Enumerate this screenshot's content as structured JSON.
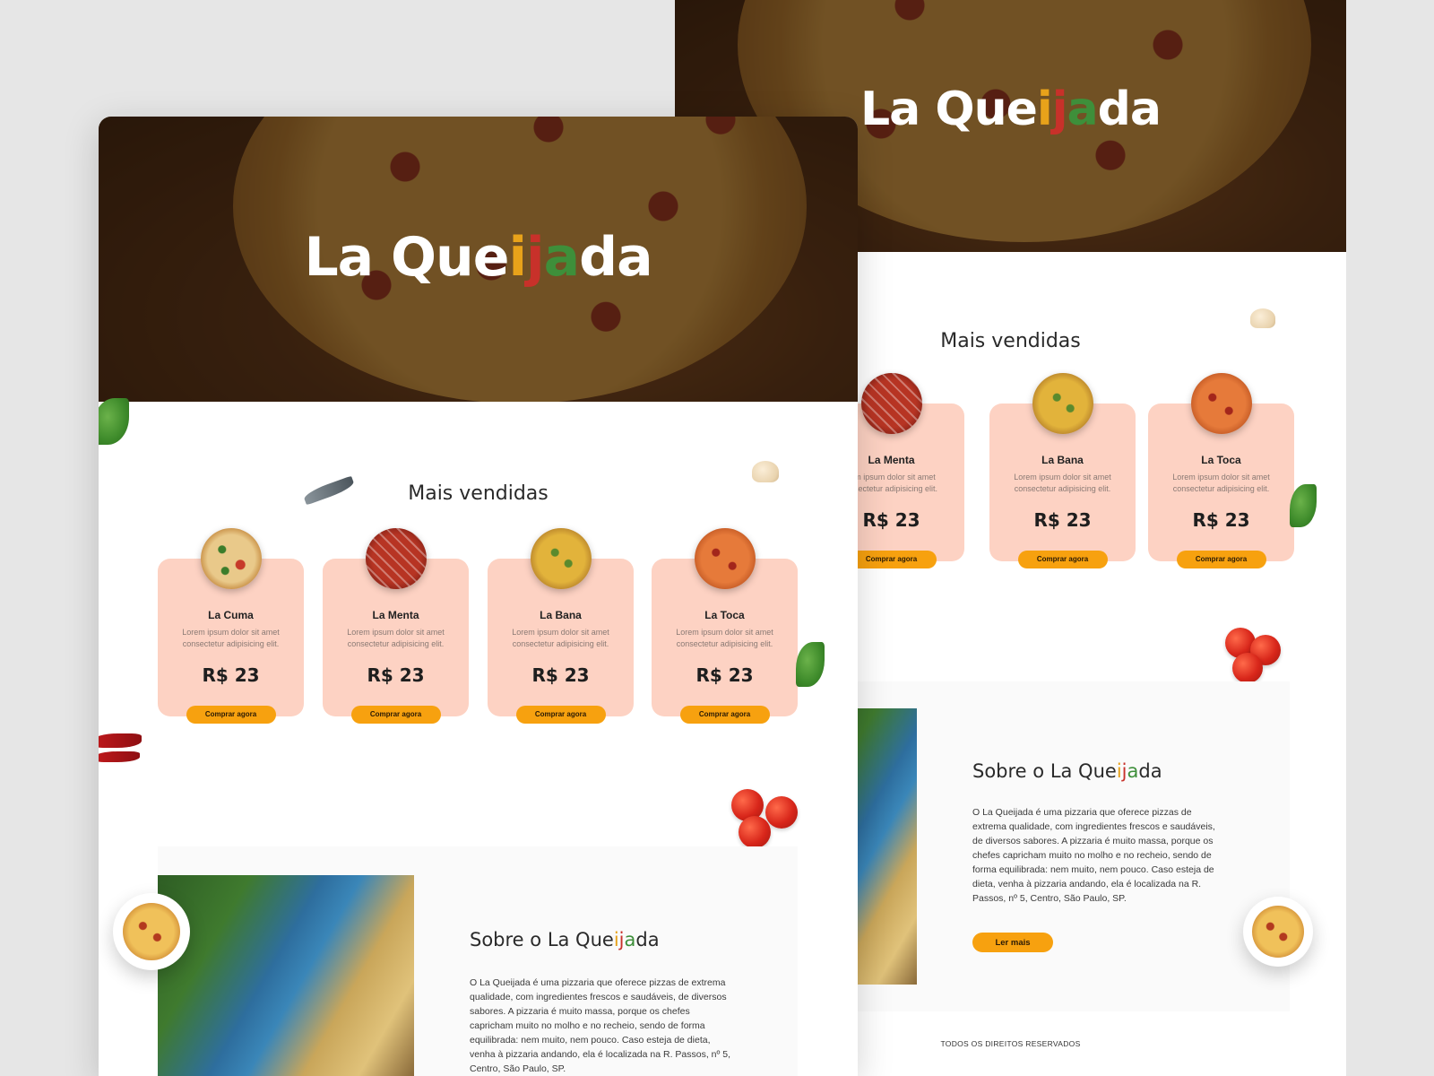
{
  "brand": {
    "name_parts": [
      "La Que",
      "i",
      "j",
      "a",
      "da"
    ]
  },
  "best_sellers": {
    "title": "Mais vendidas"
  },
  "front_products": [
    {
      "name": "La Cuma",
      "description": "Lorem ipsum dolor sit amet consectetur adipisicing elit.",
      "price": "R$ 23",
      "button": "Comprar agora",
      "image": "pizza-cuma"
    },
    {
      "name": "La Menta",
      "description": "Lorem ipsum dolor sit amet consectetur adipisicing elit.",
      "price": "R$ 23",
      "button": "Comprar agora",
      "image": "pizza-menta"
    },
    {
      "name": "La Bana",
      "description": "Lorem ipsum dolor sit amet consectetur adipisicing elit.",
      "price": "R$ 23",
      "button": "Comprar agora",
      "image": "pizza-bana"
    },
    {
      "name": "La Toca",
      "description": "Lorem ipsum dolor sit amet consectetur adipisicing elit.",
      "price": "R$ 23",
      "button": "Comprar agora",
      "image": "pizza-toca"
    }
  ],
  "back_products": [
    {
      "name": "La Menta",
      "description_partial": "rem ipsum dolor sit amet onsectetur adipisicing elit.",
      "price": "R$ 23",
      "button": "Comprar agora"
    },
    {
      "name": "La Bana",
      "description": "Lorem ipsum dolor sit amet consectetur adipisicing elit.",
      "price": "R$ 23",
      "button": "Comprar agora"
    },
    {
      "name": "La Toca",
      "description": "Lorem ipsum dolor sit amet consectetur adipisicing elit.",
      "price": "R$ 23",
      "button": "Comprar agora"
    }
  ],
  "about": {
    "title_prefix": "Sobre o ",
    "text": "O La Queijada é uma pizzaria que oferece pizzas de extrema qualidade, com ingredientes frescos e saudáveis, de diversos sabores. A pizzaria é muito massa, porque os chefes capricham muito no molho e no recheio, sendo de forma equilibrada: nem muito, nem pouco. Caso esteja de dieta, venha à pizzaria andando, ela é localizada na R. Passos, nº 5, Centro, São Paulo, SP.",
    "read_more": "Ler mais"
  },
  "footer": {
    "rights": "TODOS OS DIREITOS RESERVADOS"
  },
  "colors": {
    "accent": "#f7a10f",
    "card_bg": "#fdd2c3",
    "logo_i": "#e8a21a",
    "logo_j": "#c8312a",
    "logo_a": "#3e8f3a"
  },
  "decorations": [
    "basil-icon",
    "tomato-icon",
    "mushroom-icon",
    "chili-icon",
    "fish-icon",
    "pizza-plate-icon"
  ]
}
